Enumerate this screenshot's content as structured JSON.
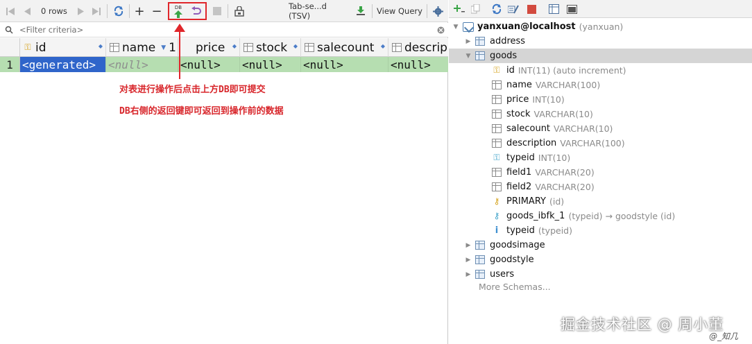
{
  "toolbar": {
    "rows_label": "0 rows",
    "tsv_label": "Tab-se...d (TSV)",
    "view_query_label": "View Query",
    "db_label": "DB"
  },
  "filter": {
    "placeholder": "<Filter criteria>"
  },
  "grid": {
    "columns": [
      "id",
      "name",
      "1",
      "price",
      "stock",
      "salecount",
      "descrip"
    ],
    "row_number": "1",
    "row": [
      "<generated>",
      "<null>",
      "<null>",
      "<null>",
      "<null>",
      "<null>"
    ]
  },
  "annotations": {
    "line1": "对表进行操作后点击上方DB即可提交",
    "line2": "DB右侧的返回键即可返回到操作前的数据"
  },
  "tree": {
    "connection": "yanxuan@localhost",
    "connection_meta": "(yanxuan)",
    "tables": [
      {
        "name": "address"
      },
      {
        "name": "goods"
      },
      {
        "name": "goodsimage"
      },
      {
        "name": "goodstyle"
      },
      {
        "name": "users"
      }
    ],
    "goods_children": [
      {
        "name": "id",
        "meta": "INT(11) (auto increment)"
      },
      {
        "name": "name",
        "meta": "VARCHAR(100)"
      },
      {
        "name": "price",
        "meta": "INT(10)"
      },
      {
        "name": "stock",
        "meta": "VARCHAR(10)"
      },
      {
        "name": "salecount",
        "meta": "VARCHAR(10)"
      },
      {
        "name": "description",
        "meta": "VARCHAR(100)"
      },
      {
        "name": "typeid",
        "meta": "INT(10)"
      },
      {
        "name": "field1",
        "meta": "VARCHAR(20)"
      },
      {
        "name": "field2",
        "meta": "VARCHAR(20)"
      },
      {
        "name": "PRIMARY",
        "meta": "(id)"
      },
      {
        "name": "goods_ibfk_1",
        "meta": "(typeid) → goodstyle (id)"
      },
      {
        "name": "typeid",
        "meta": "(typeid)"
      }
    ],
    "more_schemas": "More Schemas..."
  },
  "watermark": {
    "main": "掘金技术社区 @ 周小董",
    "corner": "@_知几"
  },
  "colors": {
    "row_bg": "#b6deb1",
    "generated_bg": "#2f65ca",
    "annotation": "#d8262b"
  }
}
